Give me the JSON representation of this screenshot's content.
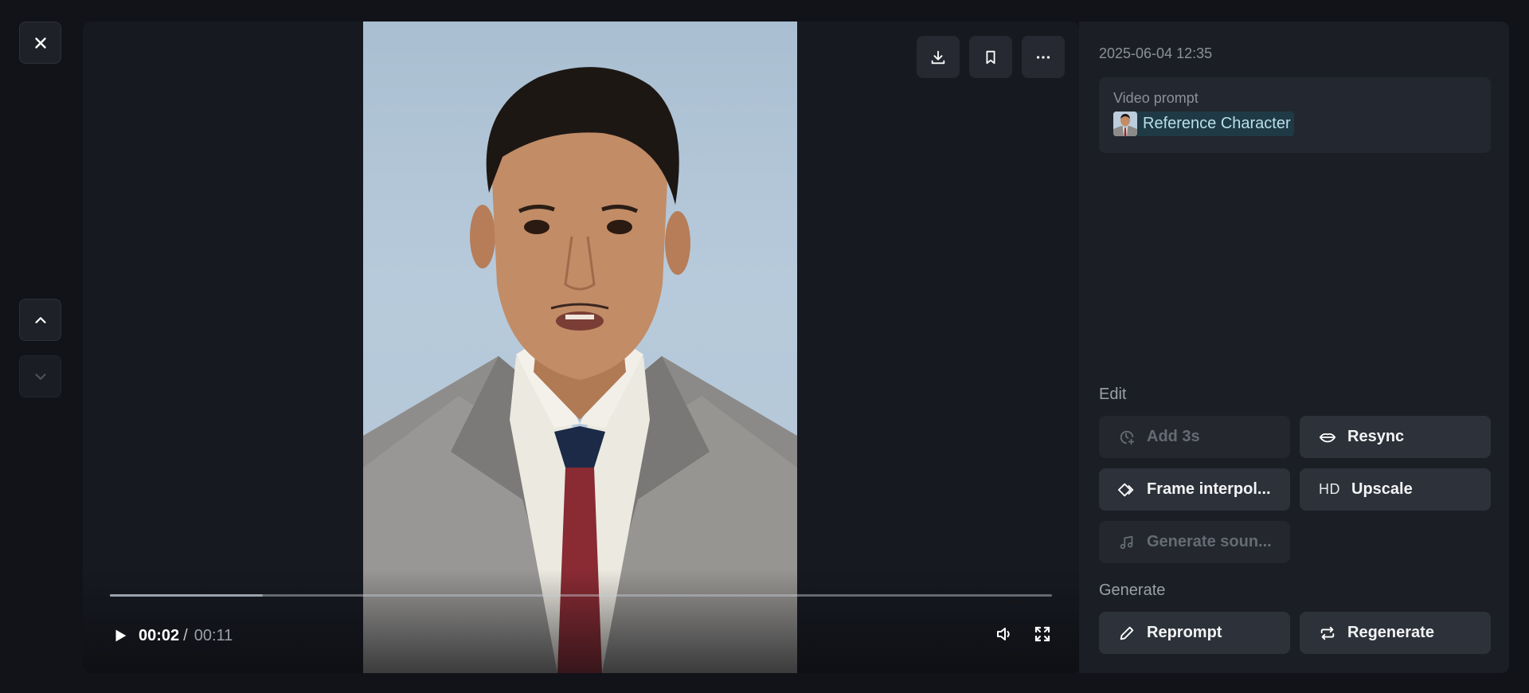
{
  "window": {
    "title": ""
  },
  "viewer": {
    "actions": [
      {
        "name": "download-button",
        "icon": "download-icon"
      },
      {
        "name": "bookmark-button",
        "icon": "bookmark-icon"
      },
      {
        "name": "more-button",
        "icon": "more-horizontal-icon"
      }
    ],
    "player": {
      "current_time": "00:02",
      "separator": "/",
      "total_time": "00:11",
      "progress": 0.162
    }
  },
  "nav": {
    "close_icon": "close-icon",
    "prev_icon": "chevron-up-icon",
    "next_icon": "chevron-down-icon"
  },
  "panel": {
    "date": "2025-06-04 12:35",
    "prompt_label": "Video prompt",
    "reference_label": "Reference Character",
    "edit_label": "Edit",
    "edit_buttons": {
      "add3s": "Add 3s",
      "resync": "Resync",
      "frame_interp": "Frame interpol...",
      "upscale_prefix": "HD",
      "upscale": "Upscale",
      "generate_sound": "Generate soun..."
    },
    "generate_label": "Generate",
    "generate_buttons": {
      "reprompt": "Reprompt",
      "regenerate": "Regenerate"
    }
  },
  "colors": {
    "background": "#111319",
    "panel": "#1b1e25",
    "button": "#2d3139",
    "accent_chip": "#1f3a44"
  }
}
